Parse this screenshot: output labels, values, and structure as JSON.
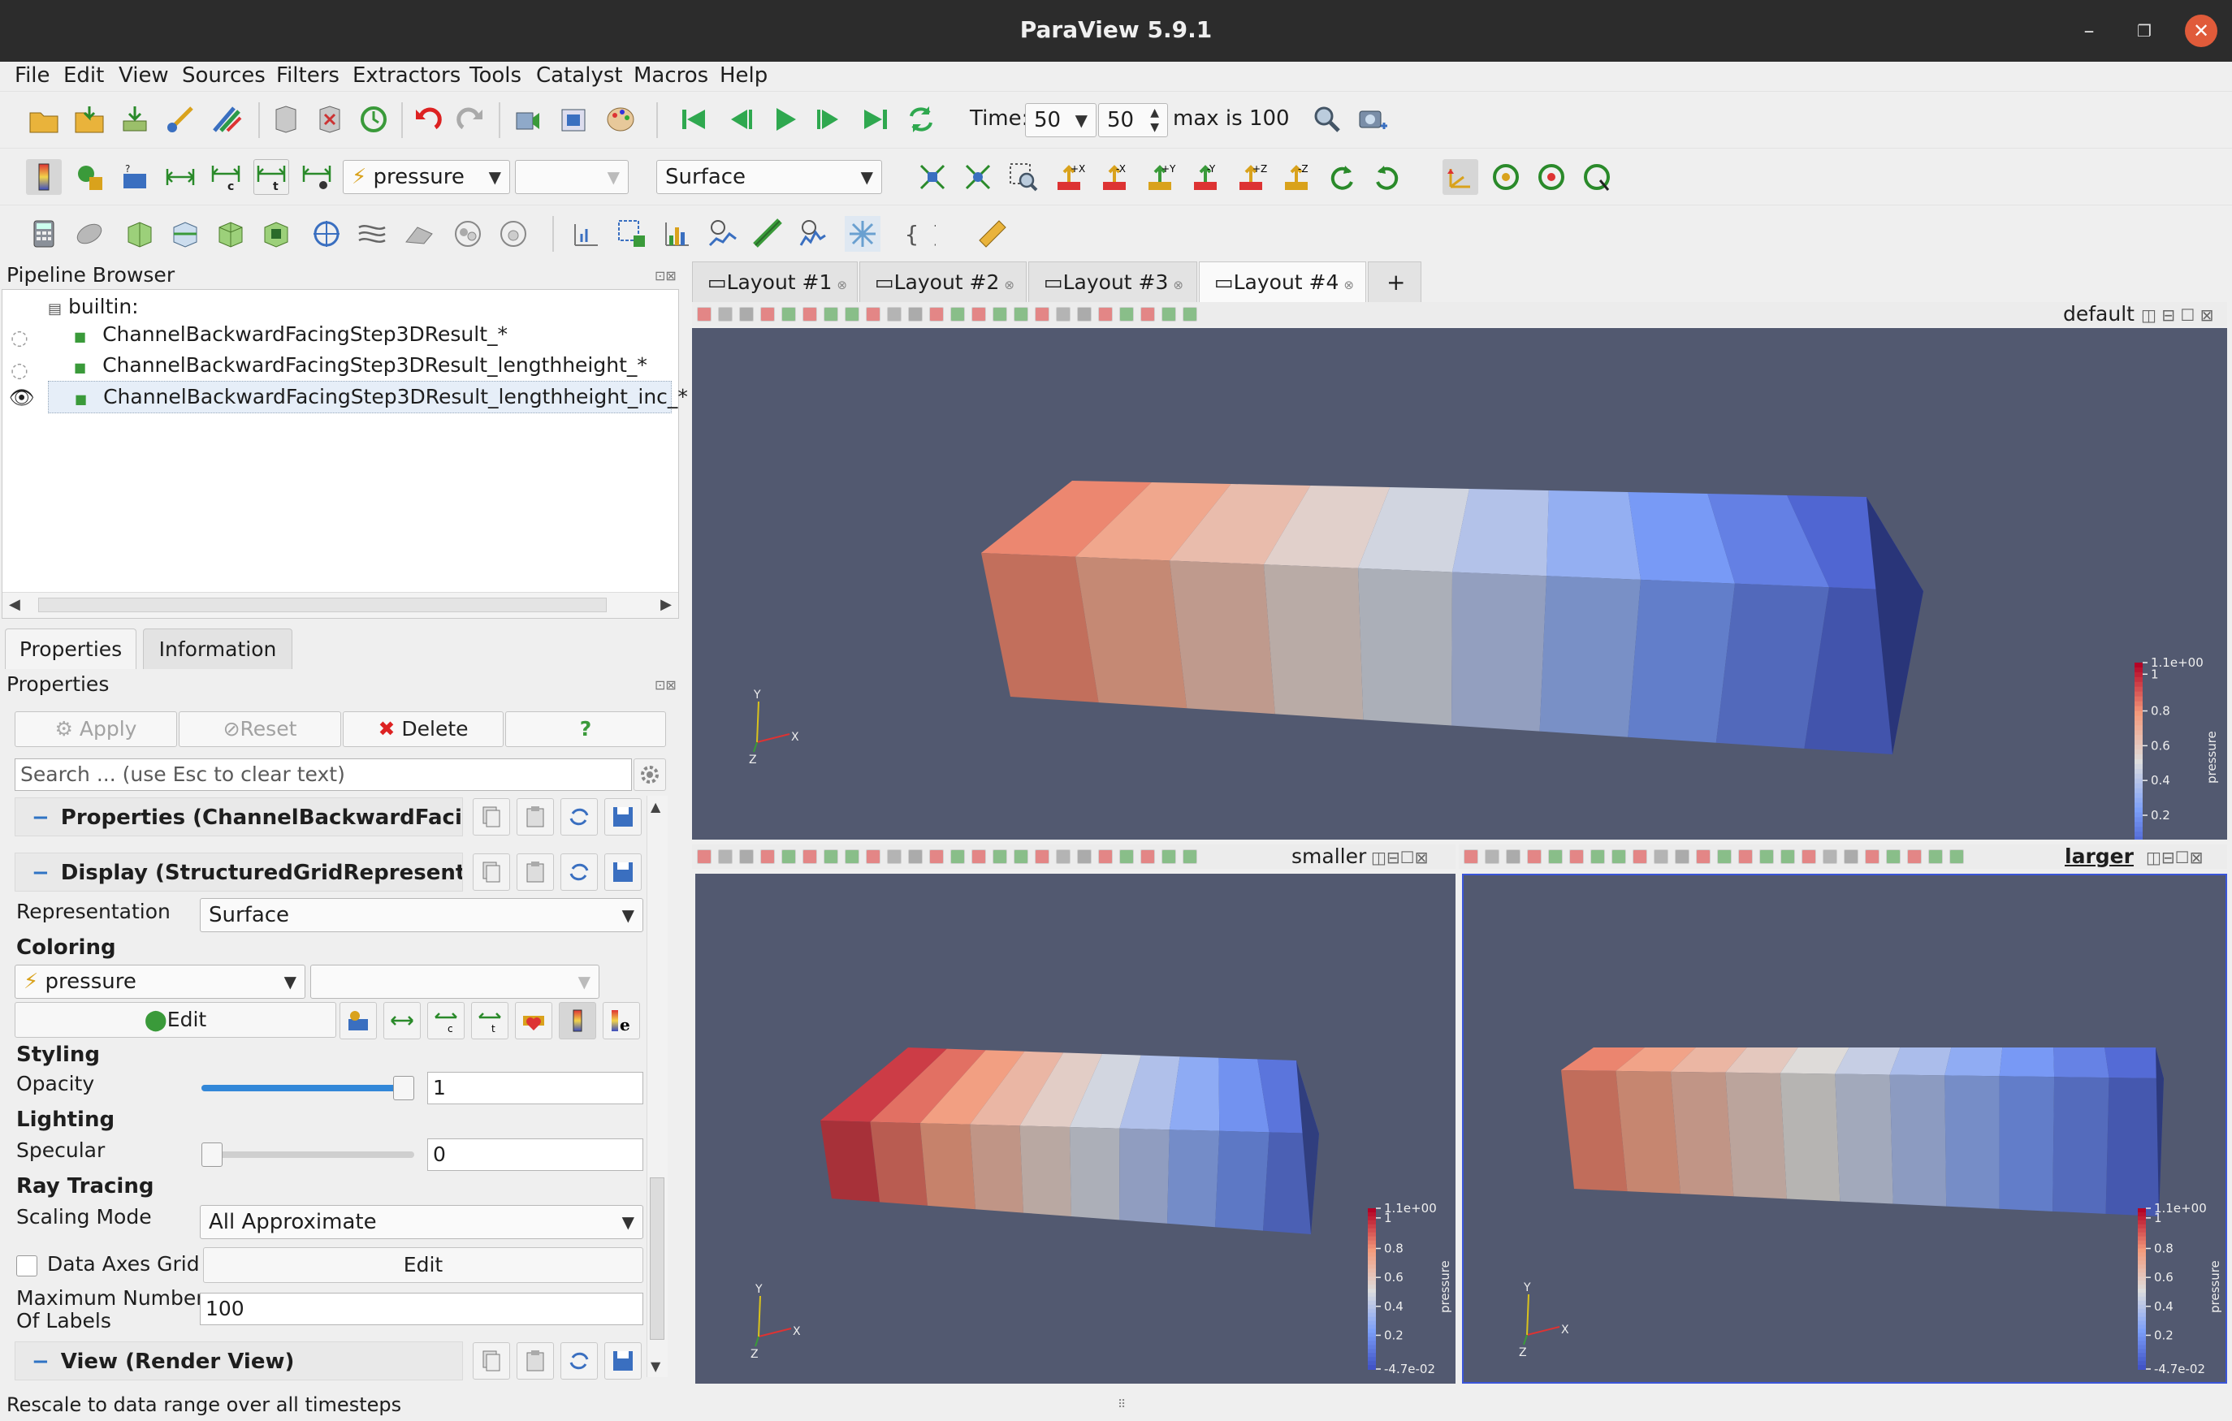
{
  "window": {
    "title": "ParaView 5.9.1"
  },
  "menu": [
    "File",
    "Edit",
    "View",
    "Sources",
    "Filters",
    "Extractors",
    "Tools",
    "Catalyst",
    "Macros",
    "Help"
  ],
  "time": {
    "label": "Time:",
    "value": "50",
    "index": "50",
    "max": "max is 100"
  },
  "toolbar2": {
    "color_by": "pressure",
    "representation": "Surface"
  },
  "pipeline": {
    "title": "Pipeline Browser",
    "root": "builtin:",
    "items": [
      "ChannelBackwardFacingStep3DResult_*",
      "ChannelBackwardFacingStep3DResult_lengthheight_*",
      "ChannelBackwardFacingStep3DResult_lengthheight_inc_*"
    ]
  },
  "tabs": [
    "Properties",
    "Information"
  ],
  "properties": {
    "title": "Properties",
    "apply": "Apply",
    "reset": "Reset",
    "delete": "Delete",
    "help": "?",
    "search_placeholder": "Search ... (use Esc to clear text)",
    "section_properties": "Properties (ChannelBackwardFacing",
    "section_display": "Display (StructuredGridRepresentat",
    "representation_label": "Representation",
    "representation_value": "Surface",
    "coloring_head": "Coloring",
    "coloring_value": "pressure",
    "edit": "Edit",
    "styling_head": "Styling",
    "opacity_label": "Opacity",
    "opacity_value": "1",
    "opacity_fraction": 1.0,
    "lighting_head": "Lighting",
    "specular_label": "Specular",
    "specular_value": "0",
    "specular_fraction": 0,
    "raytracing_head": "Ray Tracing",
    "scaling_label": "Scaling Mode",
    "scaling_value": "All Approximate",
    "data_axes_label": "Data Axes Grid",
    "data_axes_edit": "Edit",
    "max_labels_label_1": "Maximum Number",
    "max_labels_label_2": "Of Labels",
    "max_labels_value": "100",
    "section_view": "View (Render View)"
  },
  "layouts": [
    "Layout #1",
    "Layout #2",
    "Layout #3",
    "Layout #4"
  ],
  "views": {
    "top": "default",
    "bottom_left": "smaller",
    "bottom_right": "larger"
  },
  "colorbar": {
    "title": "pressure",
    "ticks": [
      "1.1e+00",
      "1",
      "0.8",
      "0.6",
      "0.4",
      "0.2",
      "-4.7e-02"
    ]
  },
  "axes": {
    "x": "X",
    "y": "Y",
    "z": "Z"
  },
  "status": "Rescale to data range over all timesteps",
  "colors": {
    "view_bg": "#525970",
    "accent": "#3287d8",
    "colormap_low": "#3b4cc0",
    "colormap_high": "#b40426"
  }
}
